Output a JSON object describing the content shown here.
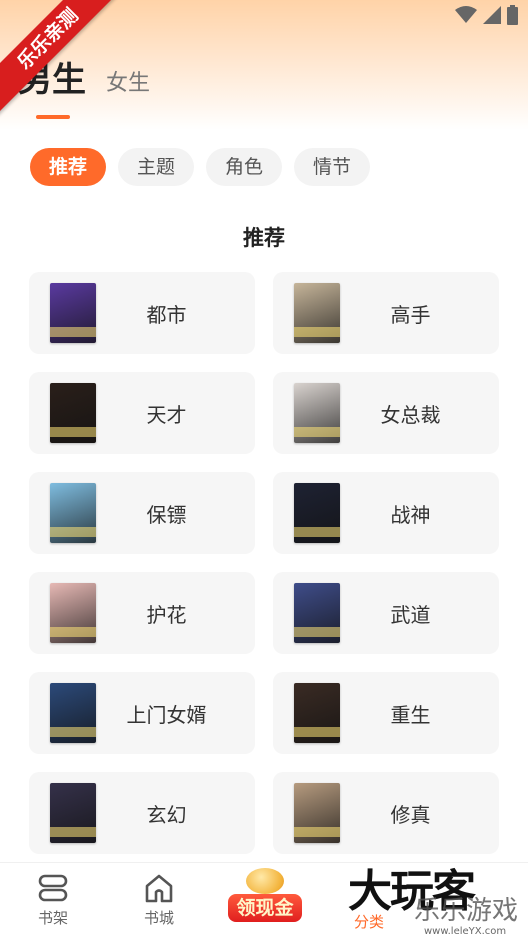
{
  "status_bar": {
    "icons": [
      "wifi-icon",
      "cell-signal-icon",
      "battery-icon"
    ]
  },
  "ribbon": {
    "text": "乐乐亲测"
  },
  "gender_tabs": {
    "male": "男生",
    "female": "女生"
  },
  "chips": [
    {
      "label": "推荐",
      "active": true
    },
    {
      "label": "主题",
      "active": false
    },
    {
      "label": "角色",
      "active": false
    },
    {
      "label": "情节",
      "active": false
    }
  ],
  "section_title": "推荐",
  "categories": [
    {
      "label": "都市",
      "cover": "#5a3aa0"
    },
    {
      "label": "高手",
      "cover": "#c6b59a"
    },
    {
      "label": "天才",
      "cover": "#2a1f1a"
    },
    {
      "label": "女总裁",
      "cover": "#d9d3cf"
    },
    {
      "label": "保镖",
      "cover": "#7fbde0"
    },
    {
      "label": "战神",
      "cover": "#1e2233"
    },
    {
      "label": "护花",
      "cover": "#e7b9b5"
    },
    {
      "label": "武道",
      "cover": "#3f4d8a"
    },
    {
      "label": "上门女婿",
      "cover": "#2c4a7a"
    },
    {
      "label": "重生",
      "cover": "#3a2b24"
    },
    {
      "label": "玄幻",
      "cover": "#35314a"
    },
    {
      "label": "修真",
      "cover": "#b69b7f"
    }
  ],
  "bottom_nav": {
    "bookshelf": "书架",
    "bookstore": "书城",
    "cash": "领现金",
    "category": "分类"
  },
  "watermark": {
    "main": "大玩客",
    "sub": "乐乐游戏",
    "url": "www.leleYX.com"
  },
  "colors": {
    "accent": "#ff6a2a",
    "ribbon": "#d81e1e"
  }
}
